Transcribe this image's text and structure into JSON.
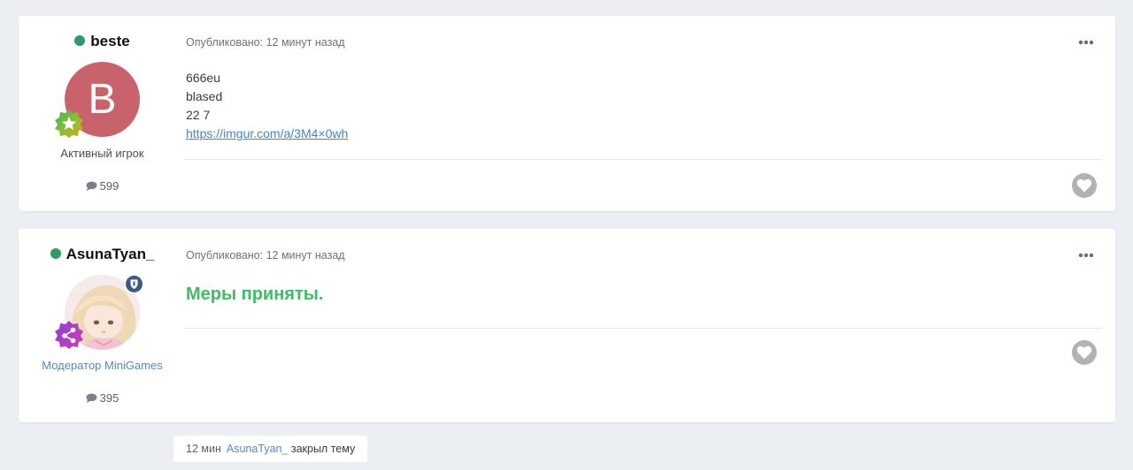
{
  "posts": [
    {
      "author": "beste",
      "avatar_letter": "B",
      "avatar_color": "#c9636b",
      "rank_title": "Активный игрок",
      "post_count": "599",
      "meta": "Опубликовано: 12 минут назад",
      "content_lines": [
        "666eu",
        "blased",
        "22 7"
      ],
      "link": "https://imgur.com/a/3M4×0wh"
    },
    {
      "author": "AsunaTyan_",
      "rank_title": "Модератор MiniGames",
      "post_count": "395",
      "meta": "Опубликовано: 12 минут назад",
      "content": "Меры приняты."
    }
  ],
  "event": {
    "time": "12 мин",
    "user": "AsunaTyan_",
    "action": "закрыл тему"
  },
  "colors": {
    "online": "#2e9a66",
    "moderator_rank": "#4a8ccf",
    "green_text": "#3dbd63",
    "link": "#3d88c9"
  },
  "icons": {
    "online": "online-status-dot",
    "rank_active": "star-rank-badge-icon",
    "rank_moderator": "share-rank-badge-icon",
    "moderator": "shield-moderator-icon",
    "comments": "comment-icon",
    "more": "more-options-icon",
    "like": "heart-icon"
  }
}
